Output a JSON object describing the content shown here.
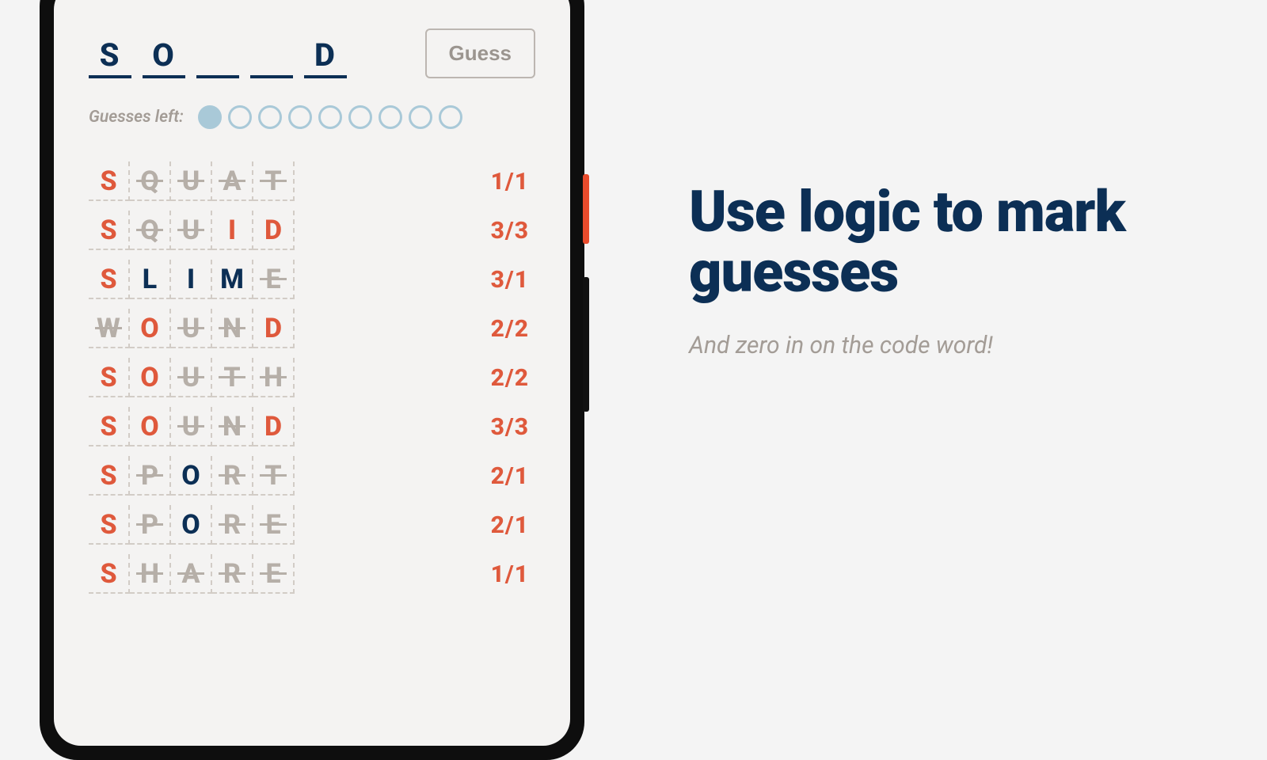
{
  "answer_slots": [
    "S",
    "O",
    "",
    "",
    "D"
  ],
  "guess_button_label": "Guess",
  "guesses_left_label": "Guesses left:",
  "guesses_total": 9,
  "guesses_used": 1,
  "guesses": [
    {
      "letters": [
        [
          "S",
          "correct"
        ],
        [
          "Q",
          "elim"
        ],
        [
          "U",
          "elim"
        ],
        [
          "A",
          "elim"
        ],
        [
          "T",
          "elim"
        ]
      ],
      "score": "1/1"
    },
    {
      "letters": [
        [
          "S",
          "correct"
        ],
        [
          "Q",
          "elim"
        ],
        [
          "U",
          "elim"
        ],
        [
          "I",
          "correct"
        ],
        [
          "D",
          "correct"
        ]
      ],
      "score": "3/3"
    },
    {
      "letters": [
        [
          "S",
          "correct"
        ],
        [
          "L",
          "marked"
        ],
        [
          "I",
          "marked"
        ],
        [
          "M",
          "marked"
        ],
        [
          "E",
          "elim"
        ]
      ],
      "score": "3/1"
    },
    {
      "letters": [
        [
          "W",
          "elim"
        ],
        [
          "O",
          "correct"
        ],
        [
          "U",
          "elim"
        ],
        [
          "N",
          "elim"
        ],
        [
          "D",
          "correct"
        ]
      ],
      "score": "2/2"
    },
    {
      "letters": [
        [
          "S",
          "correct"
        ],
        [
          "O",
          "correct"
        ],
        [
          "U",
          "elim"
        ],
        [
          "T",
          "elim"
        ],
        [
          "H",
          "elim"
        ]
      ],
      "score": "2/2"
    },
    {
      "letters": [
        [
          "S",
          "correct"
        ],
        [
          "O",
          "correct"
        ],
        [
          "U",
          "elim"
        ],
        [
          "N",
          "elim"
        ],
        [
          "D",
          "correct"
        ]
      ],
      "score": "3/3"
    },
    {
      "letters": [
        [
          "S",
          "correct"
        ],
        [
          "P",
          "elim"
        ],
        [
          "O",
          "marked"
        ],
        [
          "R",
          "elim"
        ],
        [
          "T",
          "elim"
        ]
      ],
      "score": "2/1"
    },
    {
      "letters": [
        [
          "S",
          "correct"
        ],
        [
          "P",
          "elim"
        ],
        [
          "O",
          "marked"
        ],
        [
          "R",
          "elim"
        ],
        [
          "E",
          "elim"
        ]
      ],
      "score": "2/1"
    },
    {
      "letters": [
        [
          "S",
          "correct"
        ],
        [
          "H",
          "elim"
        ],
        [
          "A",
          "elim"
        ],
        [
          "R",
          "elim"
        ],
        [
          "E",
          "elim"
        ]
      ],
      "score": "1/1"
    }
  ],
  "promo": {
    "title": "Use logic to mark guesses",
    "subtitle": "And zero in on the code word!"
  }
}
